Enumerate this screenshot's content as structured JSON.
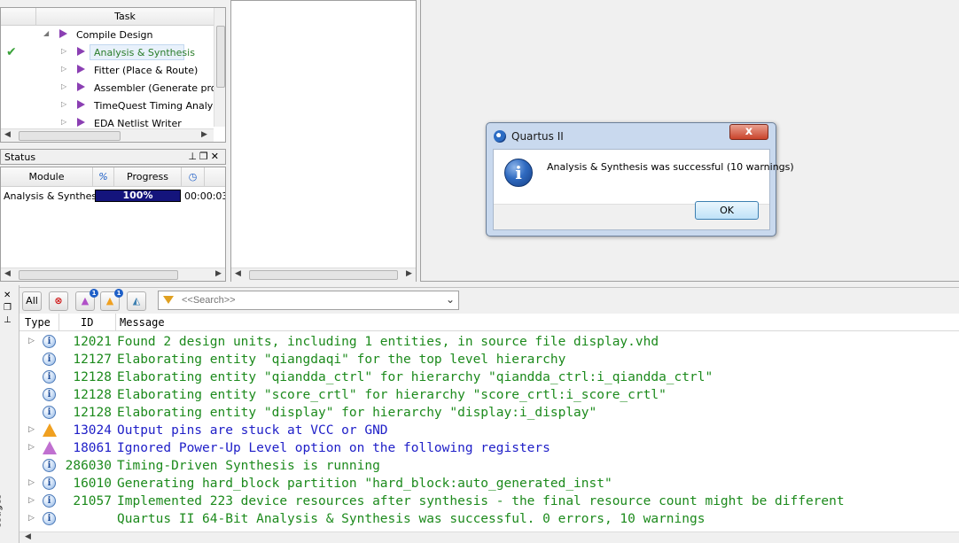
{
  "task_panel": {
    "header": "Task",
    "rows": [
      {
        "label": "Compile Design",
        "check": ""
      },
      {
        "label": "Analysis & Synthesis",
        "check": "✔"
      },
      {
        "label": "Fitter (Place & Route)",
        "check": ""
      },
      {
        "label": "Assembler (Generate progra",
        "check": ""
      },
      {
        "label": "TimeQuest Timing Analysis",
        "check": ""
      },
      {
        "label": "EDA Netlist Writer",
        "check": ""
      }
    ]
  },
  "status_panel": {
    "title": "Status",
    "columns": {
      "module": "Module",
      "pct": "%",
      "progress": "Progress"
    },
    "rows": [
      {
        "module": "Analysis & Synthesis",
        "progress": "100%",
        "time": "00:00:03",
        "progress_value": 1.0
      }
    ]
  },
  "dialog": {
    "title": "Quartus II",
    "message": "Analysis & Synthesis was successful (10 warnings)",
    "ok_label": "OK",
    "close_glyph": "x",
    "info_glyph": "i"
  },
  "messages_toolbar": {
    "all_label": "All",
    "search_placeholder": "<<Search>>",
    "badge_critical": "1",
    "badge_warning": "1"
  },
  "messages_side": {
    "label": "ssages"
  },
  "messages": {
    "columns": {
      "type": "Type",
      "id": "ID",
      "message": "Message"
    },
    "rows": [
      {
        "type": "info",
        "id": "12021",
        "text": "Found 2 design units, including 1 entities, in source file display.vhd",
        "color": "green",
        "expand": true
      },
      {
        "type": "info",
        "id": "12127",
        "text": "Elaborating entity \"qiangdaqi\" for the top level hierarchy",
        "color": "green",
        "expand": false
      },
      {
        "type": "info",
        "id": "12128",
        "text": "Elaborating entity \"qiandda_ctrl\" for hierarchy \"qiandda_ctrl:i_qiandda_ctrl\"",
        "color": "green",
        "expand": false
      },
      {
        "type": "info",
        "id": "12128",
        "text": "Elaborating entity \"score_crtl\" for hierarchy \"score_crtl:i_score_crtl\"",
        "color": "green",
        "expand": false
      },
      {
        "type": "info",
        "id": "12128",
        "text": "Elaborating entity \"display\" for hierarchy \"display:i_display\"",
        "color": "green",
        "expand": false
      },
      {
        "type": "warning",
        "id": "13024",
        "text": "Output pins are stuck at VCC or GND",
        "color": "blue",
        "expand": true
      },
      {
        "type": "critical",
        "id": "18061",
        "text": "Ignored Power-Up Level option on the following registers",
        "color": "blue",
        "expand": true
      },
      {
        "type": "info",
        "id": "286030",
        "text": "Timing-Driven Synthesis is running",
        "color": "green",
        "expand": false
      },
      {
        "type": "info",
        "id": "16010",
        "text": "Generating hard_block partition \"hard_block:auto_generated_inst\"",
        "color": "green",
        "expand": true
      },
      {
        "type": "info",
        "id": "21057",
        "text": "Implemented 223 device resources after synthesis - the final resource count might be different",
        "color": "green",
        "expand": true
      },
      {
        "type": "info",
        "id": "",
        "text": "Quartus II 64-Bit Analysis & Synthesis was successful. 0 errors, 10 warnings",
        "color": "green",
        "expand": true
      }
    ]
  },
  "colors": {
    "info_text": "#1c8a1c",
    "warning_text": "#2020c8",
    "progress_fill": "#14147c",
    "dialog_frame": "#c9d9ee"
  }
}
